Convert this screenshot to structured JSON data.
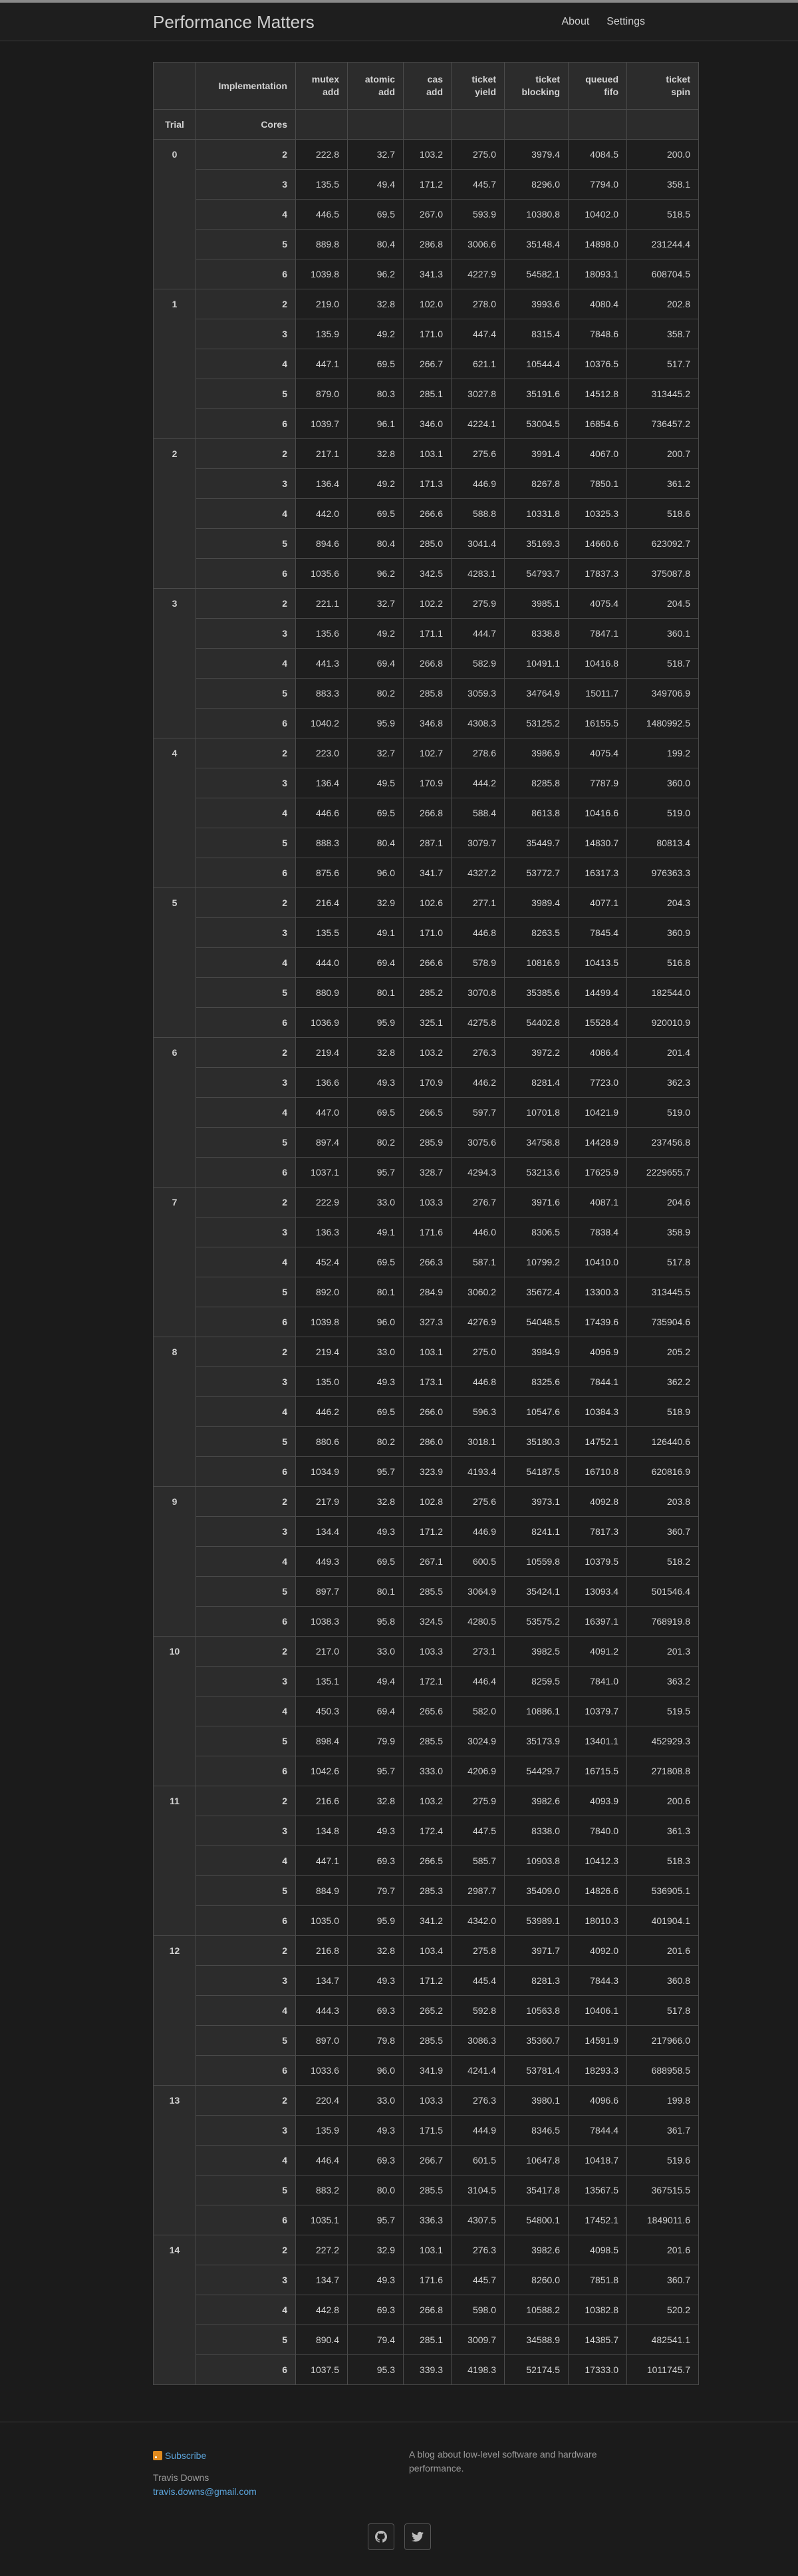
{
  "site": {
    "title": "Performance Matters",
    "nav": [
      "About",
      "Settings"
    ]
  },
  "table": {
    "corner_label": "Implementation",
    "columns": [
      [
        "mutex",
        "add"
      ],
      [
        "atomic",
        "add"
      ],
      [
        "cas",
        "add"
      ],
      [
        "ticket",
        "yield"
      ],
      [
        "ticket",
        "blocking"
      ],
      [
        "queued",
        "fifo"
      ],
      [
        "ticket",
        "spin"
      ]
    ],
    "trial_label": "Trial",
    "cores_label": "Cores",
    "trials": [
      {
        "trial": "0",
        "rows": [
          [
            "2",
            "222.8",
            "32.7",
            "103.2",
            "275.0",
            "3979.4",
            "4084.5",
            "200.0"
          ],
          [
            "3",
            "135.5",
            "49.4",
            "171.2",
            "445.7",
            "8296.0",
            "7794.0",
            "358.1"
          ],
          [
            "4",
            "446.5",
            "69.5",
            "267.0",
            "593.9",
            "10380.8",
            "10402.0",
            "518.5"
          ],
          [
            "5",
            "889.8",
            "80.4",
            "286.8",
            "3006.6",
            "35148.4",
            "14898.0",
            "231244.4"
          ],
          [
            "6",
            "1039.8",
            "96.2",
            "341.3",
            "4227.9",
            "54582.1",
            "18093.1",
            "608704.5"
          ]
        ]
      },
      {
        "trial": "1",
        "rows": [
          [
            "2",
            "219.0",
            "32.8",
            "102.0",
            "278.0",
            "3993.6",
            "4080.4",
            "202.8"
          ],
          [
            "3",
            "135.9",
            "49.2",
            "171.0",
            "447.4",
            "8315.4",
            "7848.6",
            "358.7"
          ],
          [
            "4",
            "447.1",
            "69.5",
            "266.7",
            "621.1",
            "10544.4",
            "10376.5",
            "517.7"
          ],
          [
            "5",
            "879.0",
            "80.3",
            "285.1",
            "3027.8",
            "35191.6",
            "14512.8",
            "313445.2"
          ],
          [
            "6",
            "1039.7",
            "96.1",
            "346.0",
            "4224.1",
            "53004.5",
            "16854.6",
            "736457.2"
          ]
        ]
      },
      {
        "trial": "2",
        "rows": [
          [
            "2",
            "217.1",
            "32.8",
            "103.1",
            "275.6",
            "3991.4",
            "4067.0",
            "200.7"
          ],
          [
            "3",
            "136.4",
            "49.2",
            "171.3",
            "446.9",
            "8267.8",
            "7850.1",
            "361.2"
          ],
          [
            "4",
            "442.0",
            "69.5",
            "266.6",
            "588.8",
            "10331.8",
            "10325.3",
            "518.6"
          ],
          [
            "5",
            "894.6",
            "80.4",
            "285.0",
            "3041.4",
            "35169.3",
            "14660.6",
            "623092.7"
          ],
          [
            "6",
            "1035.6",
            "96.2",
            "342.5",
            "4283.1",
            "54793.7",
            "17837.3",
            "375087.8"
          ]
        ]
      },
      {
        "trial": "3",
        "rows": [
          [
            "2",
            "221.1",
            "32.7",
            "102.2",
            "275.9",
            "3985.1",
            "4075.4",
            "204.5"
          ],
          [
            "3",
            "135.6",
            "49.2",
            "171.1",
            "444.7",
            "8338.8",
            "7847.1",
            "360.1"
          ],
          [
            "4",
            "441.3",
            "69.4",
            "266.8",
            "582.9",
            "10491.1",
            "10416.8",
            "518.7"
          ],
          [
            "5",
            "883.3",
            "80.2",
            "285.8",
            "3059.3",
            "34764.9",
            "15011.7",
            "349706.9"
          ],
          [
            "6",
            "1040.2",
            "95.9",
            "346.8",
            "4308.3",
            "53125.2",
            "16155.5",
            "1480992.5"
          ]
        ]
      },
      {
        "trial": "4",
        "rows": [
          [
            "2",
            "223.0",
            "32.7",
            "102.7",
            "278.6",
            "3986.9",
            "4075.4",
            "199.2"
          ],
          [
            "3",
            "136.4",
            "49.5",
            "170.9",
            "444.2",
            "8285.8",
            "7787.9",
            "360.0"
          ],
          [
            "4",
            "446.6",
            "69.5",
            "266.8",
            "588.4",
            "8613.8",
            "10416.6",
            "519.0"
          ],
          [
            "5",
            "888.3",
            "80.4",
            "287.1",
            "3079.7",
            "35449.7",
            "14830.7",
            "80813.4"
          ],
          [
            "6",
            "875.6",
            "96.0",
            "341.7",
            "4327.2",
            "53772.7",
            "16317.3",
            "976363.3"
          ]
        ]
      },
      {
        "trial": "5",
        "rows": [
          [
            "2",
            "216.4",
            "32.9",
            "102.6",
            "277.1",
            "3989.4",
            "4077.1",
            "204.3"
          ],
          [
            "3",
            "135.5",
            "49.1",
            "171.0",
            "446.8",
            "8263.5",
            "7845.4",
            "360.9"
          ],
          [
            "4",
            "444.0",
            "69.4",
            "266.6",
            "578.9",
            "10816.9",
            "10413.5",
            "516.8"
          ],
          [
            "5",
            "880.9",
            "80.1",
            "285.2",
            "3070.8",
            "35385.6",
            "14499.4",
            "182544.0"
          ],
          [
            "6",
            "1036.9",
            "95.9",
            "325.1",
            "4275.8",
            "54402.8",
            "15528.4",
            "920010.9"
          ]
        ]
      },
      {
        "trial": "6",
        "rows": [
          [
            "2",
            "219.4",
            "32.8",
            "103.2",
            "276.3",
            "3972.2",
            "4086.4",
            "201.4"
          ],
          [
            "3",
            "136.6",
            "49.3",
            "170.9",
            "446.2",
            "8281.4",
            "7723.0",
            "362.3"
          ],
          [
            "4",
            "447.0",
            "69.5",
            "266.5",
            "597.7",
            "10701.8",
            "10421.9",
            "519.0"
          ],
          [
            "5",
            "897.4",
            "80.2",
            "285.9",
            "3075.6",
            "34758.8",
            "14428.9",
            "237456.8"
          ],
          [
            "6",
            "1037.1",
            "95.7",
            "328.7",
            "4294.3",
            "53213.6",
            "17625.9",
            "2229655.7"
          ]
        ]
      },
      {
        "trial": "7",
        "rows": [
          [
            "2",
            "222.9",
            "33.0",
            "103.3",
            "276.7",
            "3971.6",
            "4087.1",
            "204.6"
          ],
          [
            "3",
            "136.3",
            "49.1",
            "171.6",
            "446.0",
            "8306.5",
            "7838.4",
            "358.9"
          ],
          [
            "4",
            "452.4",
            "69.5",
            "266.3",
            "587.1",
            "10799.2",
            "10410.0",
            "517.8"
          ],
          [
            "5",
            "892.0",
            "80.1",
            "284.9",
            "3060.2",
            "35672.4",
            "13300.3",
            "313445.5"
          ],
          [
            "6",
            "1039.8",
            "96.0",
            "327.3",
            "4276.9",
            "54048.5",
            "17439.6",
            "735904.6"
          ]
        ]
      },
      {
        "trial": "8",
        "rows": [
          [
            "2",
            "219.4",
            "33.0",
            "103.1",
            "275.0",
            "3984.9",
            "4096.9",
            "205.2"
          ],
          [
            "3",
            "135.0",
            "49.3",
            "173.1",
            "446.8",
            "8325.6",
            "7844.1",
            "362.2"
          ],
          [
            "4",
            "446.2",
            "69.5",
            "266.0",
            "596.3",
            "10547.6",
            "10384.3",
            "518.9"
          ],
          [
            "5",
            "880.6",
            "80.2",
            "286.0",
            "3018.1",
            "35180.3",
            "14752.1",
            "126440.6"
          ],
          [
            "6",
            "1034.9",
            "95.7",
            "323.9",
            "4193.4",
            "54187.5",
            "16710.8",
            "620816.9"
          ]
        ]
      },
      {
        "trial": "9",
        "rows": [
          [
            "2",
            "217.9",
            "32.8",
            "102.8",
            "275.6",
            "3973.1",
            "4092.8",
            "203.8"
          ],
          [
            "3",
            "134.4",
            "49.3",
            "171.2",
            "446.9",
            "8241.1",
            "7817.3",
            "360.7"
          ],
          [
            "4",
            "449.3",
            "69.5",
            "267.1",
            "600.5",
            "10559.8",
            "10379.5",
            "518.2"
          ],
          [
            "5",
            "897.7",
            "80.1",
            "285.5",
            "3064.9",
            "35424.1",
            "13093.4",
            "501546.4"
          ],
          [
            "6",
            "1038.3",
            "95.8",
            "324.5",
            "4280.5",
            "53575.2",
            "16397.1",
            "768919.8"
          ]
        ]
      },
      {
        "trial": "10",
        "rows": [
          [
            "2",
            "217.0",
            "33.0",
            "103.3",
            "273.1",
            "3982.5",
            "4091.2",
            "201.3"
          ],
          [
            "3",
            "135.1",
            "49.4",
            "172.1",
            "446.4",
            "8259.5",
            "7841.0",
            "363.2"
          ],
          [
            "4",
            "450.3",
            "69.4",
            "265.6",
            "582.0",
            "10886.1",
            "10379.7",
            "519.5"
          ],
          [
            "5",
            "898.4",
            "79.9",
            "285.5",
            "3024.9",
            "35173.9",
            "13401.1",
            "452929.3"
          ],
          [
            "6",
            "1042.6",
            "95.7",
            "333.0",
            "4206.9",
            "54429.7",
            "16715.5",
            "271808.8"
          ]
        ]
      },
      {
        "trial": "11",
        "rows": [
          [
            "2",
            "216.6",
            "32.8",
            "103.2",
            "275.9",
            "3982.6",
            "4093.9",
            "200.6"
          ],
          [
            "3",
            "134.8",
            "49.3",
            "172.4",
            "447.5",
            "8338.0",
            "7840.0",
            "361.3"
          ],
          [
            "4",
            "447.1",
            "69.3",
            "266.5",
            "585.7",
            "10903.8",
            "10412.3",
            "518.3"
          ],
          [
            "5",
            "884.9",
            "79.7",
            "285.3",
            "2987.7",
            "35409.0",
            "14826.6",
            "536905.1"
          ],
          [
            "6",
            "1035.0",
            "95.9",
            "341.2",
            "4342.0",
            "53989.1",
            "18010.3",
            "401904.1"
          ]
        ]
      },
      {
        "trial": "12",
        "rows": [
          [
            "2",
            "216.8",
            "32.8",
            "103.4",
            "275.8",
            "3971.7",
            "4092.0",
            "201.6"
          ],
          [
            "3",
            "134.7",
            "49.3",
            "171.2",
            "445.4",
            "8281.3",
            "7844.3",
            "360.8"
          ],
          [
            "4",
            "444.3",
            "69.3",
            "265.2",
            "592.8",
            "10563.8",
            "10406.1",
            "517.8"
          ],
          [
            "5",
            "897.0",
            "79.8",
            "285.5",
            "3086.3",
            "35360.7",
            "14591.9",
            "217966.0"
          ],
          [
            "6",
            "1033.6",
            "96.0",
            "341.9",
            "4241.4",
            "53781.4",
            "18293.3",
            "688958.5"
          ]
        ]
      },
      {
        "trial": "13",
        "rows": [
          [
            "2",
            "220.4",
            "33.0",
            "103.3",
            "276.3",
            "3980.1",
            "4096.6",
            "199.8"
          ],
          [
            "3",
            "135.9",
            "49.3",
            "171.5",
            "444.9",
            "8346.5",
            "7844.4",
            "361.7"
          ],
          [
            "4",
            "446.4",
            "69.3",
            "266.7",
            "601.5",
            "10647.8",
            "10418.7",
            "519.6"
          ],
          [
            "5",
            "883.2",
            "80.0",
            "285.5",
            "3104.5",
            "35417.8",
            "13567.5",
            "367515.5"
          ],
          [
            "6",
            "1035.1",
            "95.7",
            "336.3",
            "4307.5",
            "54800.1",
            "17452.1",
            "1849011.6"
          ]
        ]
      },
      {
        "trial": "14",
        "rows": [
          [
            "2",
            "227.2",
            "32.9",
            "103.1",
            "276.3",
            "3982.6",
            "4098.5",
            "201.6"
          ],
          [
            "3",
            "134.7",
            "49.3",
            "171.6",
            "445.7",
            "8260.0",
            "7851.8",
            "360.7"
          ],
          [
            "4",
            "442.8",
            "69.3",
            "266.8",
            "598.0",
            "10588.2",
            "10382.8",
            "520.2"
          ],
          [
            "5",
            "890.4",
            "79.4",
            "285.1",
            "3009.7",
            "34588.9",
            "14385.7",
            "482541.1"
          ],
          [
            "6",
            "1037.5",
            "95.3",
            "339.3",
            "4198.3",
            "52174.5",
            "17333.0",
            "1011745.7"
          ]
        ]
      }
    ]
  },
  "footer": {
    "subscribe": "Subscribe",
    "author": "Travis Downs",
    "email": "travis.downs@gmail.com",
    "description": "A blog about low-level software and hardware performance.",
    "social": [
      {
        "name": "github-icon"
      },
      {
        "name": "twitter-icon"
      }
    ]
  },
  "colors": {
    "background": "#1b1b1b",
    "header_cell": "#2c2c2c",
    "link": "#5aa2d8",
    "rss": "#e08a1e"
  }
}
